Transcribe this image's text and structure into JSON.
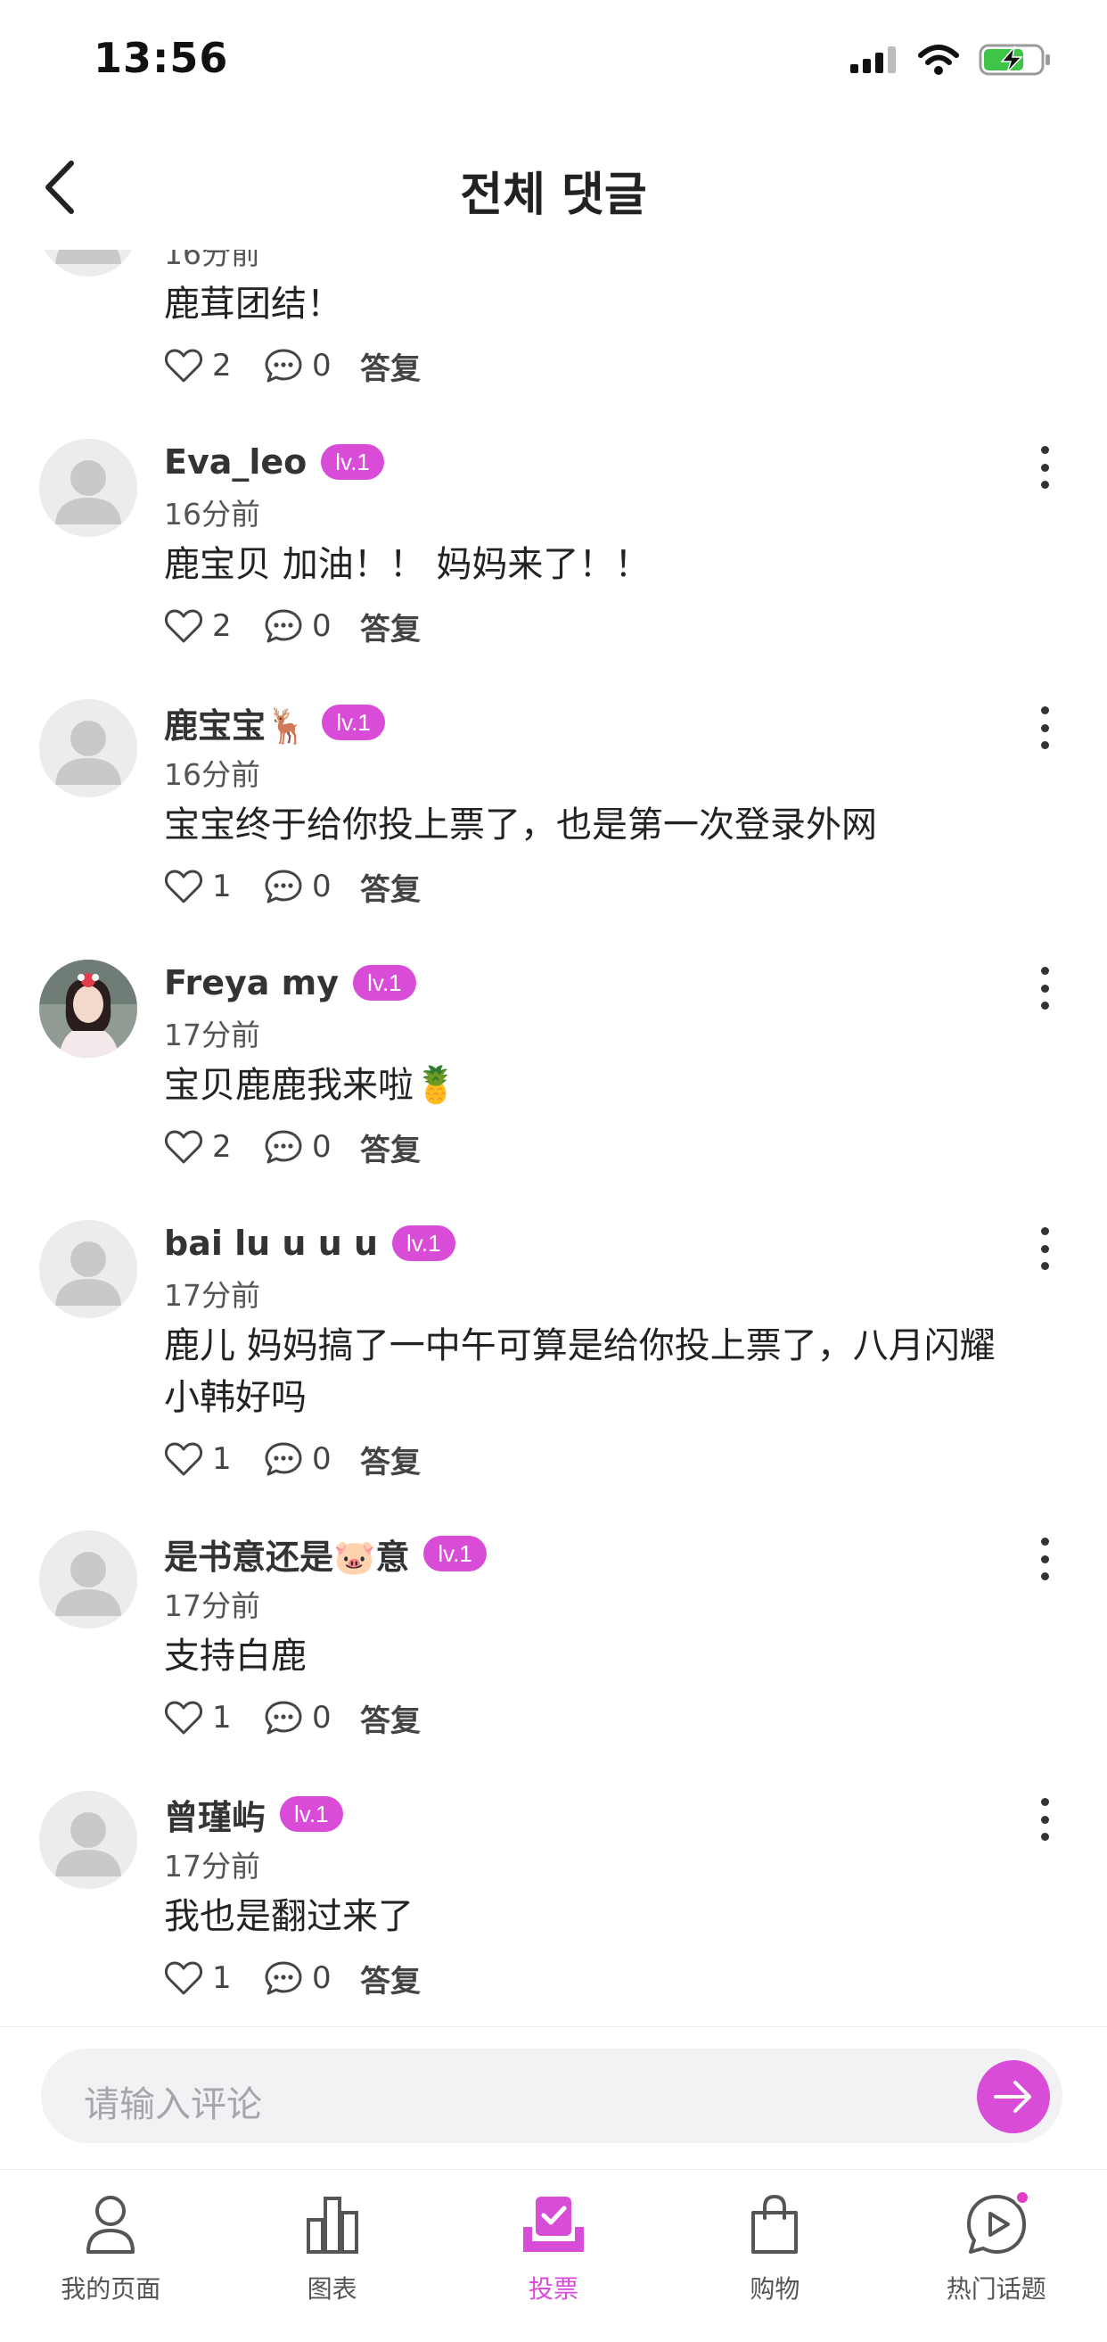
{
  "status_bar": {
    "time": "13:56"
  },
  "header": {
    "title": "전체 댓글"
  },
  "comments": [
    {
      "username": "",
      "level": "",
      "time": "16分前",
      "text": "鹿茸团结！",
      "likes": "2",
      "replies": "0",
      "reply_label": "答复"
    },
    {
      "username": "Eva_leo",
      "level": "lv.1",
      "time": "16分前",
      "text": "鹿宝贝 加油！！ 妈妈来了！！",
      "likes": "2",
      "replies": "0",
      "reply_label": "答复"
    },
    {
      "username": "鹿宝宝🦌",
      "level": "lv.1",
      "time": "16分前",
      "text": "宝宝终于给你投上票了，也是第一次登录外网",
      "likes": "1",
      "replies": "0",
      "reply_label": "答复"
    },
    {
      "username": "Freya my",
      "level": "lv.1",
      "time": "17分前",
      "text": "宝贝鹿鹿我来啦🍍",
      "likes": "2",
      "replies": "0",
      "reply_label": "答复"
    },
    {
      "username": "bai lu u u u",
      "level": "lv.1",
      "time": "17分前",
      "text": "鹿儿 妈妈搞了一中午可算是给你投上票了，八月闪耀小韩好吗",
      "likes": "1",
      "replies": "0",
      "reply_label": "答复"
    },
    {
      "username": "是书意还是🐷意",
      "level": "lv.1",
      "time": "17分前",
      "text": "支持白鹿",
      "likes": "1",
      "replies": "0",
      "reply_label": "答复"
    },
    {
      "username": "曾瑾屿",
      "level": "lv.1",
      "time": "17分前",
      "text": "我也是翻过来了",
      "likes": "1",
      "replies": "0",
      "reply_label": "答复"
    }
  ],
  "input": {
    "placeholder": "请输入评论"
  },
  "tabs": [
    {
      "label": "我的页面",
      "icon": "person-icon"
    },
    {
      "label": "图表",
      "icon": "chart-icon"
    },
    {
      "label": "投票",
      "icon": "vote-icon",
      "active": true
    },
    {
      "label": "购物",
      "icon": "shopping-bag-icon"
    },
    {
      "label": "热门话题",
      "icon": "play-chat-icon"
    }
  ],
  "colors": {
    "accent": "#d94cd8",
    "badge": "#d94cd8",
    "text": "#222222",
    "muted": "#555555"
  }
}
